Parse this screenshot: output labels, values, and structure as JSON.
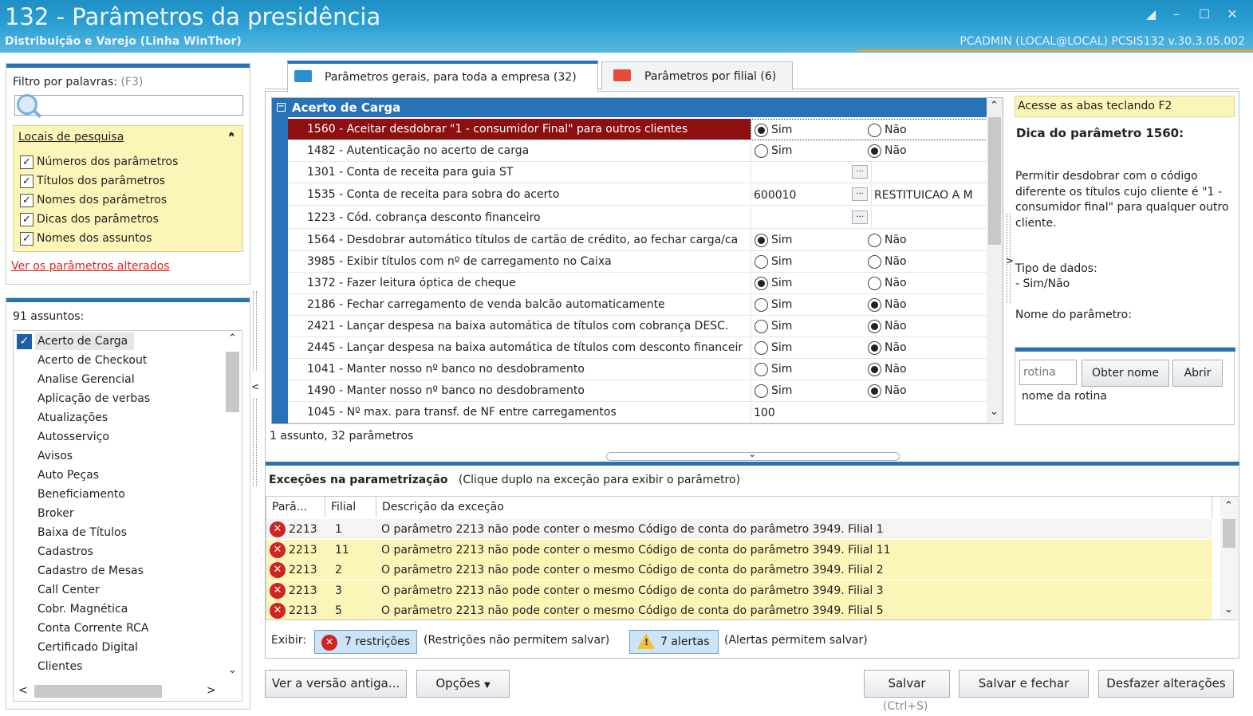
{
  "window": {
    "title": "132 - Parâmetros da presidência",
    "subtitle": "Distribuição e Varejo (Linha WinThor)",
    "user_info": "PCADMIN (LOCAL@LOCAL)   PCSIS132  v.30.3.05.002"
  },
  "filter": {
    "label": "Filtro por palavras:",
    "shortcut": "(F3)",
    "search_value": "",
    "locais_title": "Locais de pesquisa",
    "options": [
      {
        "label": "Números dos parâmetros",
        "checked": true
      },
      {
        "label": "Títulos dos parâmetros",
        "checked": true
      },
      {
        "label": "Nomes dos parâmetros",
        "checked": true
      },
      {
        "label": "Dicas dos parâmetros",
        "checked": true
      },
      {
        "label": "Nomes dos assuntos",
        "checked": true
      }
    ],
    "ver_alterados": "Ver os parâmetros alterados"
  },
  "assuntos": {
    "count_label": "91 assuntos:",
    "items": [
      "Acerto de Carga",
      "Acerto de Checkout",
      "Analise Gerencial",
      "Aplicação de verbas",
      "Atualizações",
      "Autosserviço",
      "Avisos",
      "Auto Peças",
      "Beneficiamento",
      "Broker",
      "Baixa de Títulos",
      "Cadastros",
      "Cadastro de Mesas",
      "Call Center",
      "Cobr. Magnética",
      "Conta Corrente RCA",
      "Certificado Digital",
      "Clientes"
    ]
  },
  "tabs": [
    {
      "label": "Parâmetros gerais, para toda a empresa",
      "count": "(32)"
    },
    {
      "label": "Parâmetros por filial",
      "count": "(6)"
    }
  ],
  "grid": {
    "group": "Acerto de Carga",
    "rows": [
      {
        "text": "1560 - Aceitar desdobrar \"1 - consumidor Final\" para outros clientes",
        "type": "radio",
        "value": "Sim"
      },
      {
        "text": "1482 - Autenticação no acerto de carga",
        "type": "radio",
        "value": "Não"
      },
      {
        "text": "1301 - Conta de receita para guia ST",
        "type": "lookup",
        "code": "",
        "desc": ""
      },
      {
        "text": "1535 - Conta de receita para sobra do acerto",
        "type": "lookup",
        "code": "600010",
        "desc": "RESTITUICAO A M"
      },
      {
        "text": "1223 - Cód. cobrança desconto financeiro",
        "type": "lookup",
        "code": "",
        "desc": ""
      },
      {
        "text": "1564 - Desdobrar automático títulos de cartão de crédito, ao fechar carga/ca",
        "type": "radio",
        "value": "Sim"
      },
      {
        "text": "3985 - Exibir títulos com nº de carregamento no Caixa",
        "type": "radio",
        "value": ""
      },
      {
        "text": "1372 - Fazer leitura óptica de cheque",
        "type": "radio",
        "value": "Sim"
      },
      {
        "text": "2186 - Fechar carregamento de venda balcão automaticamente",
        "type": "radio",
        "value": "Não"
      },
      {
        "text": "2421 - Lançar despesa na baixa automática de títulos com cobrança DESC.",
        "type": "radio",
        "value": "Não"
      },
      {
        "text": "2445 - Lançar despesa na baixa automática de títulos com desconto financeir",
        "type": "radio",
        "value": "Não"
      },
      {
        "text": "1041 - Manter nosso nº banco no desdobramento",
        "type": "radio",
        "value": "Não"
      },
      {
        "text": "1490 - Manter nosso nº banco no desdobramento",
        "type": "radio",
        "value": "Não"
      },
      {
        "text": "1045 - Nº max. para transf. de NF entre carregamentos",
        "type": "text",
        "value": "100"
      }
    ],
    "sim_label": "Sim",
    "nao_label": "Não",
    "lookup_btn": "...",
    "status": "1 assunto, 32 parâmetros"
  },
  "hint": {
    "bar": "Acesse as abas teclando F2",
    "title": "Dica do parâmetro 1560:",
    "body": "Permitir desdobrar com o código diferente os títulos cujo cliente é \"1 - consumidor final\" para qualquer outro cliente.",
    "tipo_label": "Tipo de dados:",
    "tipo_value": "- Sim/Não",
    "nome_label": "Nome do parâmetro:",
    "rotina_placeholder": "rotina",
    "obter_nome": "Obter nome",
    "abrir": "Abrir",
    "nome_rotina": "nome da rotina"
  },
  "exceptions": {
    "title": "Exceções na parametrização",
    "note": "(Clique duplo na exceção para exibir o parâmetro)",
    "columns": [
      "Parâ...",
      "Filial",
      "Descrição da exceção"
    ],
    "rows": [
      {
        "param": "2213",
        "filial": "1",
        "desc": "O parâmetro 2213 não pode conter o mesmo Código de conta do parâmetro 3949. Filial 1"
      },
      {
        "param": "2213",
        "filial": "11",
        "desc": "O parâmetro 2213 não pode conter o mesmo Código de conta do parâmetro 3949. Filial 11"
      },
      {
        "param": "2213",
        "filial": "2",
        "desc": "O parâmetro 2213 não pode conter o mesmo Código de conta do parâmetro 3949. Filial 2"
      },
      {
        "param": "2213",
        "filial": "3",
        "desc": "O parâmetro 2213 não pode conter o mesmo Código de conta do parâmetro 3949. Filial 3"
      },
      {
        "param": "2213",
        "filial": "5",
        "desc": "O parâmetro 2213 não pode conter o mesmo Código de conta do parâmetro 3949. Filial 5"
      }
    ],
    "exibir": "Exibir:",
    "restricoes": "7 restrições",
    "restricoes_note": "(Restrições não permitem salvar)",
    "alertas": "7 alertas",
    "alertas_note": "(Alertas permitem salvar)"
  },
  "buttons": {
    "versao_antiga": "Ver a versão antiga...",
    "opcoes": "Opções",
    "salvar": "Salvar",
    "salvar_hint": "(Ctrl+S)",
    "salvar_fechar": "Salvar e fechar",
    "desfazer": "Desfazer alterações"
  },
  "colors": {
    "accent": "#2873b8",
    "selected_row": "#8e0f0f",
    "highlight": "#fbf6b8",
    "error": "#d02323",
    "link": "#d22222"
  }
}
